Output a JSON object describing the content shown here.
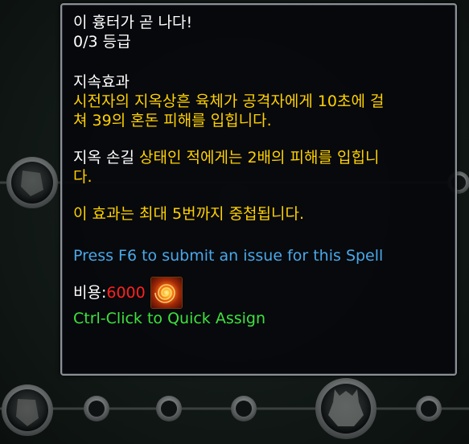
{
  "tooltip": {
    "title": "이 흉터가 곧 나다!",
    "rank": "0/3 등급",
    "section_header": "지속효과",
    "effect_line1": "시전자의 지옥상흔 육체가 공격자에게 10초에 걸",
    "effect_line2": "쳐 39의 혼돈 피해를 입힙니다.",
    "debuff_name": "지옥 손길",
    "debuff_text_a": " 상태인 적에게는 2배의 피해를 입힙니",
    "debuff_text_b": "다.",
    "stack_text": "이 효과는 최대 5번까지 중첩됩니다.",
    "report_text": "Press F6 to submit an issue for this Spell",
    "cost_label": "비용: ",
    "cost_value": "6000",
    "cost_icon": "chaos-orb-icon",
    "assign_text": "Ctrl-Click to Quick Assign"
  },
  "colors": {
    "title": "#ffffff",
    "effect": "#ffd100",
    "report": "#4aa8e8",
    "assign": "#3ee23e",
    "cost_value": "#ff2020"
  }
}
